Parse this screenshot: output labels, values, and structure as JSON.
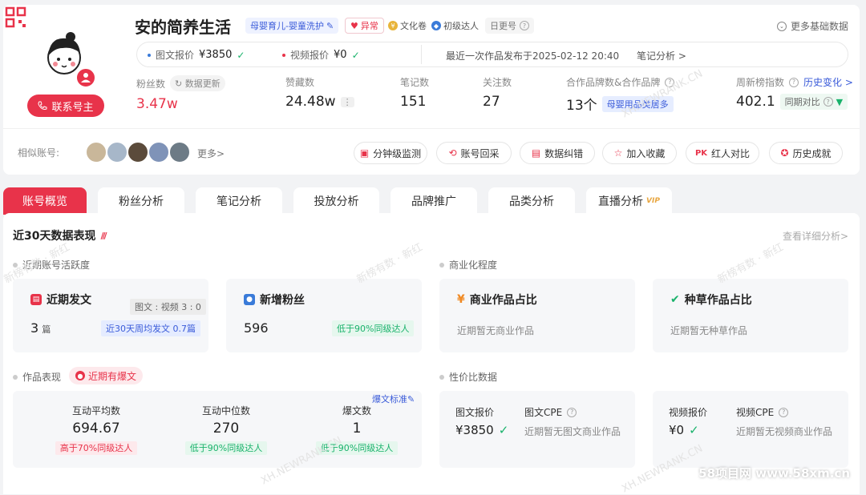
{
  "profile": {
    "name": "安的简养生活",
    "category_tag": "母婴育儿-婴童洗护",
    "abnormal_tag": "异常",
    "culture_tag": "文化卷",
    "level_tag": "初级达人",
    "daily_tag": "日更号",
    "contact_button": "联系号主",
    "more_info": "更多基础数据"
  },
  "prices": {
    "image_label": "图文报价",
    "image_value": "¥3850",
    "video_label": "视频报价",
    "video_value": "¥0",
    "last_publish": "最近一次作品发布于2025-02-12 20:40",
    "note_analysis": "笔记分析 >"
  },
  "stats": {
    "fans_label": "粉丝数",
    "data_update": "数据更新",
    "fans_value": "3.47w",
    "likes_label": "赞藏数",
    "likes_value": "24.48w",
    "notes_label": "笔记数",
    "notes_value": "151",
    "follow_label": "关注数",
    "follow_value": "27",
    "brand_label": "合作品牌数&合作品牌",
    "brand_value": "13个",
    "brand_tag": "母婴用品类居多",
    "rank_label": "周新榜指数",
    "rank_history": "历史变化 >",
    "rank_value": "402.1",
    "rank_compare": "同期对比"
  },
  "similar": {
    "label": "相似账号:",
    "more": "更多>"
  },
  "actions": [
    "分钟级监测",
    "账号回采",
    "数据纠错",
    "加入收藏",
    "红人对比",
    "历史成就"
  ],
  "tabs": [
    "账号概览",
    "粉丝分析",
    "笔记分析",
    "投放分析",
    "品牌推广",
    "品类分析",
    "直播分析"
  ],
  "vip": "VIP",
  "overview": {
    "title": "近30天数据表现",
    "detail_link": "查看详细分析>",
    "activity_title": "近期账号活跃度",
    "commercial_title": "商业化程度",
    "recent_posts": {
      "title": "近期发文",
      "ratio": "图文 : 视频 3 : 0",
      "value": "3",
      "unit": "篇",
      "avg": "近30天周均发文 0.7篇"
    },
    "new_fans": {
      "title": "新增粉丝",
      "value": "596",
      "compare": "低于90%同级达人"
    },
    "commercial_ratio": {
      "title": "商业作品占比",
      "empty": "近期暂无商业作品"
    },
    "seeding_ratio": {
      "title": "种草作品占比",
      "empty": "近期暂无种草作品"
    },
    "works_title": "作品表现",
    "hot_tag": "近期有爆文",
    "hot_standard": "爆文标准",
    "works": [
      {
        "label": "互动平均数",
        "value": "694.67",
        "compare": "高于70%同级达人"
      },
      {
        "label": "互动中位数",
        "value": "270",
        "compare": "低于90%同级达人"
      },
      {
        "label": "爆文数",
        "value": "1",
        "compare": "低于90%同级达人"
      }
    ],
    "value_title": "性价比数据",
    "image_price_label": "图文报价",
    "image_price": "¥3850",
    "image_cpe_label": "图文CPE",
    "image_cpe_empty": "近期暂无图文商业作品",
    "video_price_label": "视频报价",
    "video_price": "¥0",
    "video_cpe_label": "视频CPE",
    "video_cpe_empty": "近期暂无视频商业作品"
  },
  "watermarks": {
    "brand": "新榜有数 · 新红",
    "url": "XH.NEWRANK.CN",
    "site": "58项目网 www.58xm.cn"
  },
  "colors": {
    "accent": "#e8334a",
    "positive": "#19b26b",
    "link": "#3a5bd9"
  }
}
